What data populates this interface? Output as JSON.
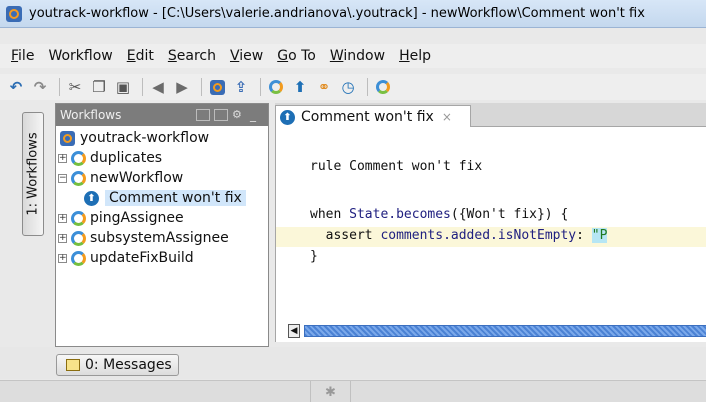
{
  "window": {
    "title": "youtrack-workflow - [C:\\Users\\valerie.andrianova\\.youtrack] - newWorkflow\\Comment won't fix"
  },
  "menu": [
    {
      "label": "File",
      "key": "F",
      "rest": "ile"
    },
    {
      "label": "Workflow",
      "key": "",
      "rest": "Workflow"
    },
    {
      "label": "Edit",
      "key": "E",
      "rest": "dit"
    },
    {
      "label": "Search",
      "key": "S",
      "rest": "earch"
    },
    {
      "label": "View",
      "key": "V",
      "rest": "iew"
    },
    {
      "label": "Go To",
      "key": "G",
      "rest": "o To"
    },
    {
      "label": "Window",
      "key": "W",
      "rest": "indow"
    },
    {
      "label": "Help",
      "key": "H",
      "rest": "elp"
    }
  ],
  "toolbar": {
    "icons": [
      "undo-icon",
      "redo-icon",
      "cut-icon",
      "copy-icon",
      "paste-icon",
      "back-icon",
      "forward-icon",
      "youtrack-icon",
      "upload-icon",
      "workflow-icon",
      "rule-icon",
      "link-icon",
      "schedule-icon",
      "attach-workflow-icon"
    ]
  },
  "sidebar_tab": {
    "label": "1: Workflows"
  },
  "workflows_panel": {
    "title": "Workflows",
    "tree": [
      {
        "label": "youtrack-workflow",
        "level": 0,
        "icon": "project-icon",
        "expander": ""
      },
      {
        "label": "duplicates",
        "level": 1,
        "icon": "workflow-icon",
        "expander": "+"
      },
      {
        "label": "newWorkflow",
        "level": 1,
        "icon": "workflow-icon",
        "expander": "−"
      },
      {
        "label": "Comment won't fix",
        "level": 2,
        "icon": "rule-icon",
        "expander": "",
        "selected": true
      },
      {
        "label": "pingAssignee",
        "level": 1,
        "icon": "workflow-icon",
        "expander": "+"
      },
      {
        "label": "subsystemAssignee",
        "level": 1,
        "icon": "workflow-icon",
        "expander": "+"
      },
      {
        "label": "updateFixBuild",
        "level": 1,
        "icon": "workflow-icon",
        "expander": "+"
      }
    ]
  },
  "editor": {
    "tab_label": "Comment won't fix",
    "tab_close": "×",
    "line1": "rule Comment won't fix",
    "line2a": "when ",
    "line2b": "State.becomes",
    "line2c": "({Won't fix}) {",
    "line3a": "  assert ",
    "line3b": "comments.added.isNotEmpty",
    "line3c": ": ",
    "line3d": "\"P",
    "line4": "}"
  },
  "bottom": {
    "messages_label": "0: Messages"
  }
}
